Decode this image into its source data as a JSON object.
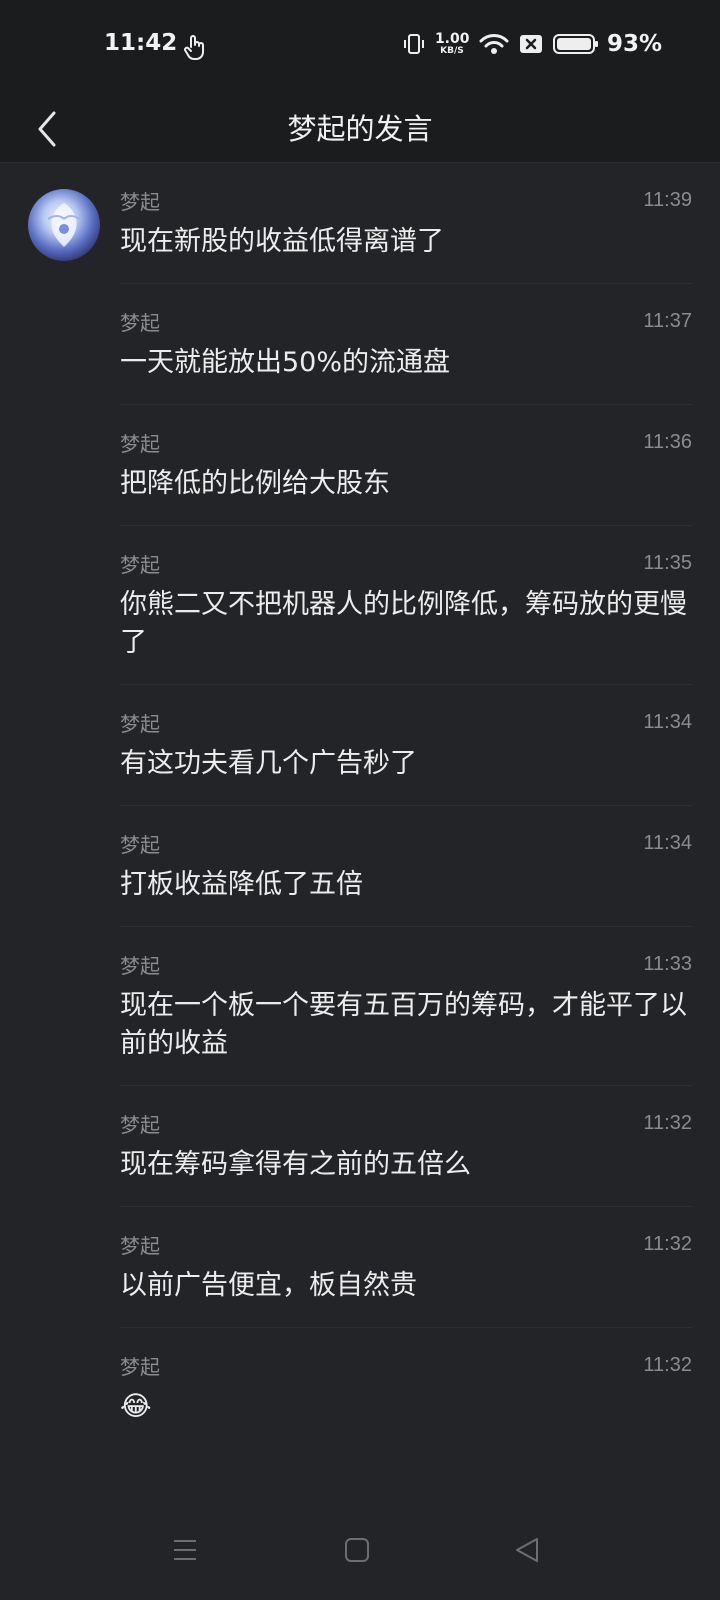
{
  "status_bar": {
    "time": "11:42",
    "net_speed_value": "1.00",
    "net_speed_unit": "KB/S",
    "battery_percent": "93%",
    "icons": [
      "touch-icon",
      "vibrate-icon",
      "wifi-icon",
      "sim-blocked-icon",
      "battery-icon"
    ]
  },
  "header": {
    "title": "梦起的发言",
    "back_icon": "chevron-left-icon"
  },
  "messages": [
    {
      "sender": "梦起",
      "time": "11:39",
      "text": "现在新股的收益低得离谱了",
      "show_avatar": true
    },
    {
      "sender": "梦起",
      "time": "11:37",
      "text": "一天就能放出50%的流通盘"
    },
    {
      "sender": "梦起",
      "time": "11:36",
      "text": "把降低的比例给大股东"
    },
    {
      "sender": "梦起",
      "time": "11:35",
      "text": "你熊二又不把机器人的比例降低，筹码放的更慢了"
    },
    {
      "sender": "梦起",
      "time": "11:34",
      "text": "有这功夫看几个广告秒了"
    },
    {
      "sender": "梦起",
      "time": "11:34",
      "text": "打板收益降低了五倍"
    },
    {
      "sender": "梦起",
      "time": "11:33",
      "text": "现在一个板一个要有五百万的筹码，才能平了以前的收益"
    },
    {
      "sender": "梦起",
      "time": "11:32",
      "text": "现在筹码拿得有之前的五倍么"
    },
    {
      "sender": "梦起",
      "time": "11:32",
      "text": "以前广告便宜，板自然贵"
    },
    {
      "sender": "梦起",
      "time": "11:32",
      "text": "😂"
    }
  ],
  "nav_bar": {
    "icons": [
      "menu-icon",
      "home-square-icon",
      "back-triangle-icon"
    ]
  },
  "colors": {
    "background": "#232427",
    "bar_background": "#1b1c1e",
    "text_primary": "#ececed",
    "text_secondary": "#8a8b8f"
  }
}
